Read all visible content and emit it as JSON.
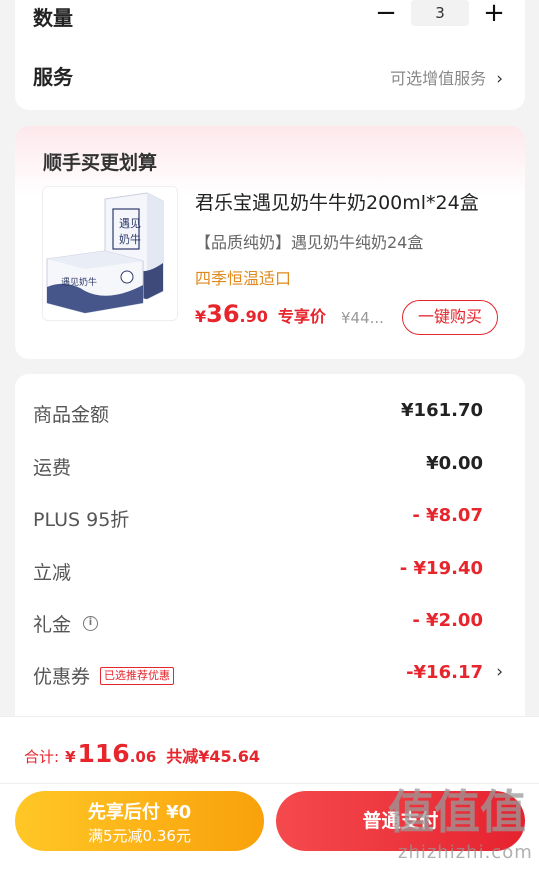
{
  "quantity": {
    "label": "数量",
    "minus": "−",
    "value": "3",
    "plus": "+"
  },
  "service": {
    "label": "服务",
    "value": "可选增值服务",
    "chevron": "›"
  },
  "addon": {
    "title": "顺手买更划算",
    "product": {
      "name": "君乐宝遇见奶牛牛奶200ml*24盒",
      "subtitle": "【品质纯奶】遇见奶牛纯奶24盒",
      "tag": "四季恒温适口",
      "price_symbol": "¥",
      "price_int": "36",
      "price_dec": ".90",
      "price_label": "专享价",
      "original_price": "¥44...",
      "buy_label": "一键购买",
      "image_text": "遇见奶牛"
    }
  },
  "summary": {
    "rows": [
      {
        "label": "商品金额",
        "value": "¥161.70"
      },
      {
        "label": "运费",
        "value": "¥0.00"
      },
      {
        "label": "PLUS 95折",
        "value": "- ¥8.07"
      },
      {
        "label": "立减",
        "value": "- ¥19.40"
      },
      {
        "label": "礼金",
        "value": "- ¥2.00",
        "info_icon": "i"
      },
      {
        "label": "优惠券",
        "value": "-¥16.17",
        "badge": "已选推荐优惠",
        "chevron": "›"
      }
    ]
  },
  "footer": {
    "total_label": "合计:",
    "total_symbol": "¥",
    "total_int": "116",
    "total_dec": ".06",
    "saved": "共减¥45.64",
    "paylater_title": "先享后付 ¥0",
    "paylater_sub": "满5元减0.36元",
    "normal_pay": "普通支付"
  },
  "watermark": {
    "logo": "值值值",
    "text": "zhizhizhi.com"
  },
  "colors": {
    "accent_red": "#e6252d",
    "paylater_orange": "#f9a10b",
    "tag_orange": "#e08a1e"
  }
}
